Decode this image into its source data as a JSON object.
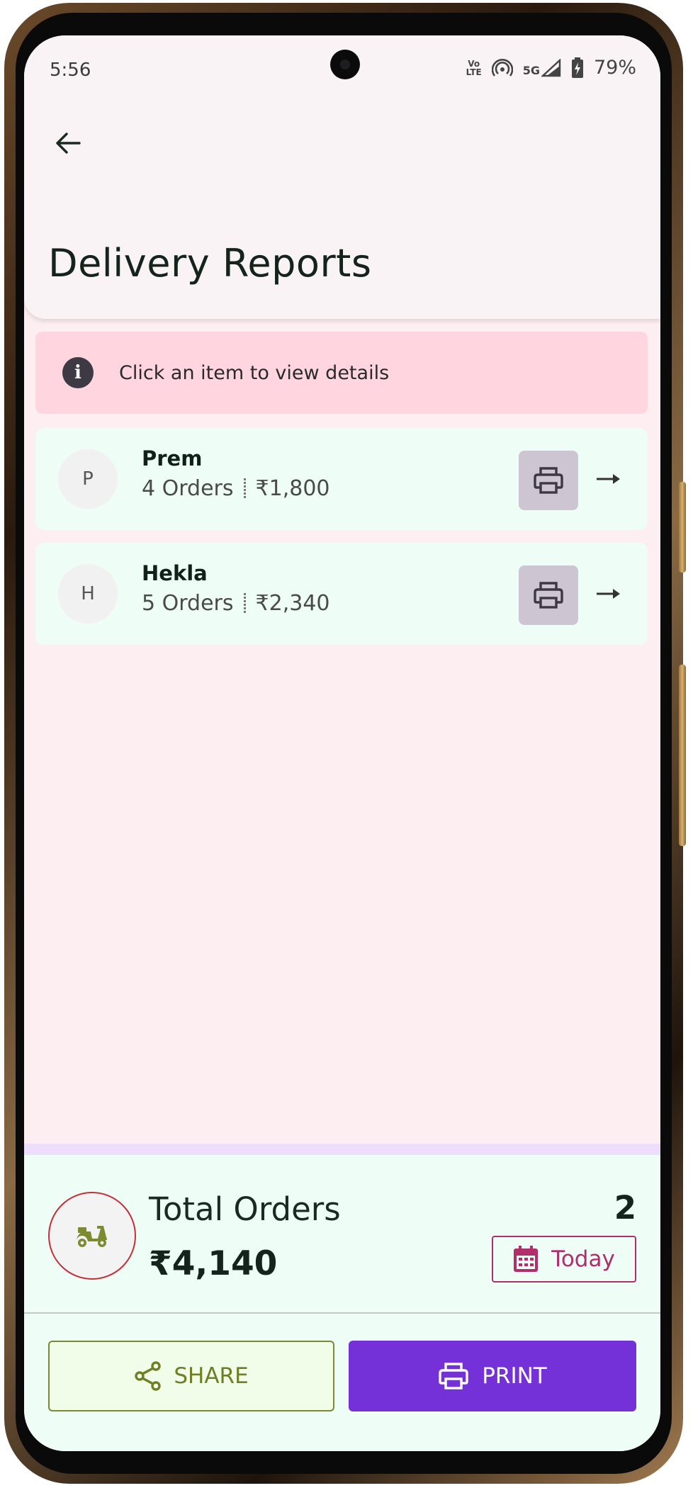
{
  "status_bar": {
    "time": "5:56",
    "volte_top": "Vo",
    "volte_bottom": "LTE",
    "net_label": "5G",
    "battery": "79%"
  },
  "app_bar": {
    "back_icon": "arrow-left-icon",
    "title": "Delivery Reports"
  },
  "info_banner": {
    "icon": "info-icon",
    "icon_glyph": "i",
    "text": "Click an item to view details"
  },
  "reports": [
    {
      "initial": "P",
      "name": "Prem",
      "orders": "4 Orders",
      "amount": "₹1,800"
    },
    {
      "initial": "H",
      "name": "Hekla",
      "orders": "5 Orders",
      "amount": "₹2,340"
    }
  ],
  "summary": {
    "label": "Total Orders",
    "amount": "₹4,140",
    "count": "2",
    "date_filter": "Today",
    "icon": "scooter-icon"
  },
  "actions": {
    "share_label": "SHARE",
    "print_label": "PRINT"
  },
  "colors": {
    "accent": "#7431d8",
    "info_bg": "#ffd6df",
    "card_bg": "#effdf7",
    "date_accent": "#b02e6a",
    "share_accent": "#6f7f23"
  }
}
